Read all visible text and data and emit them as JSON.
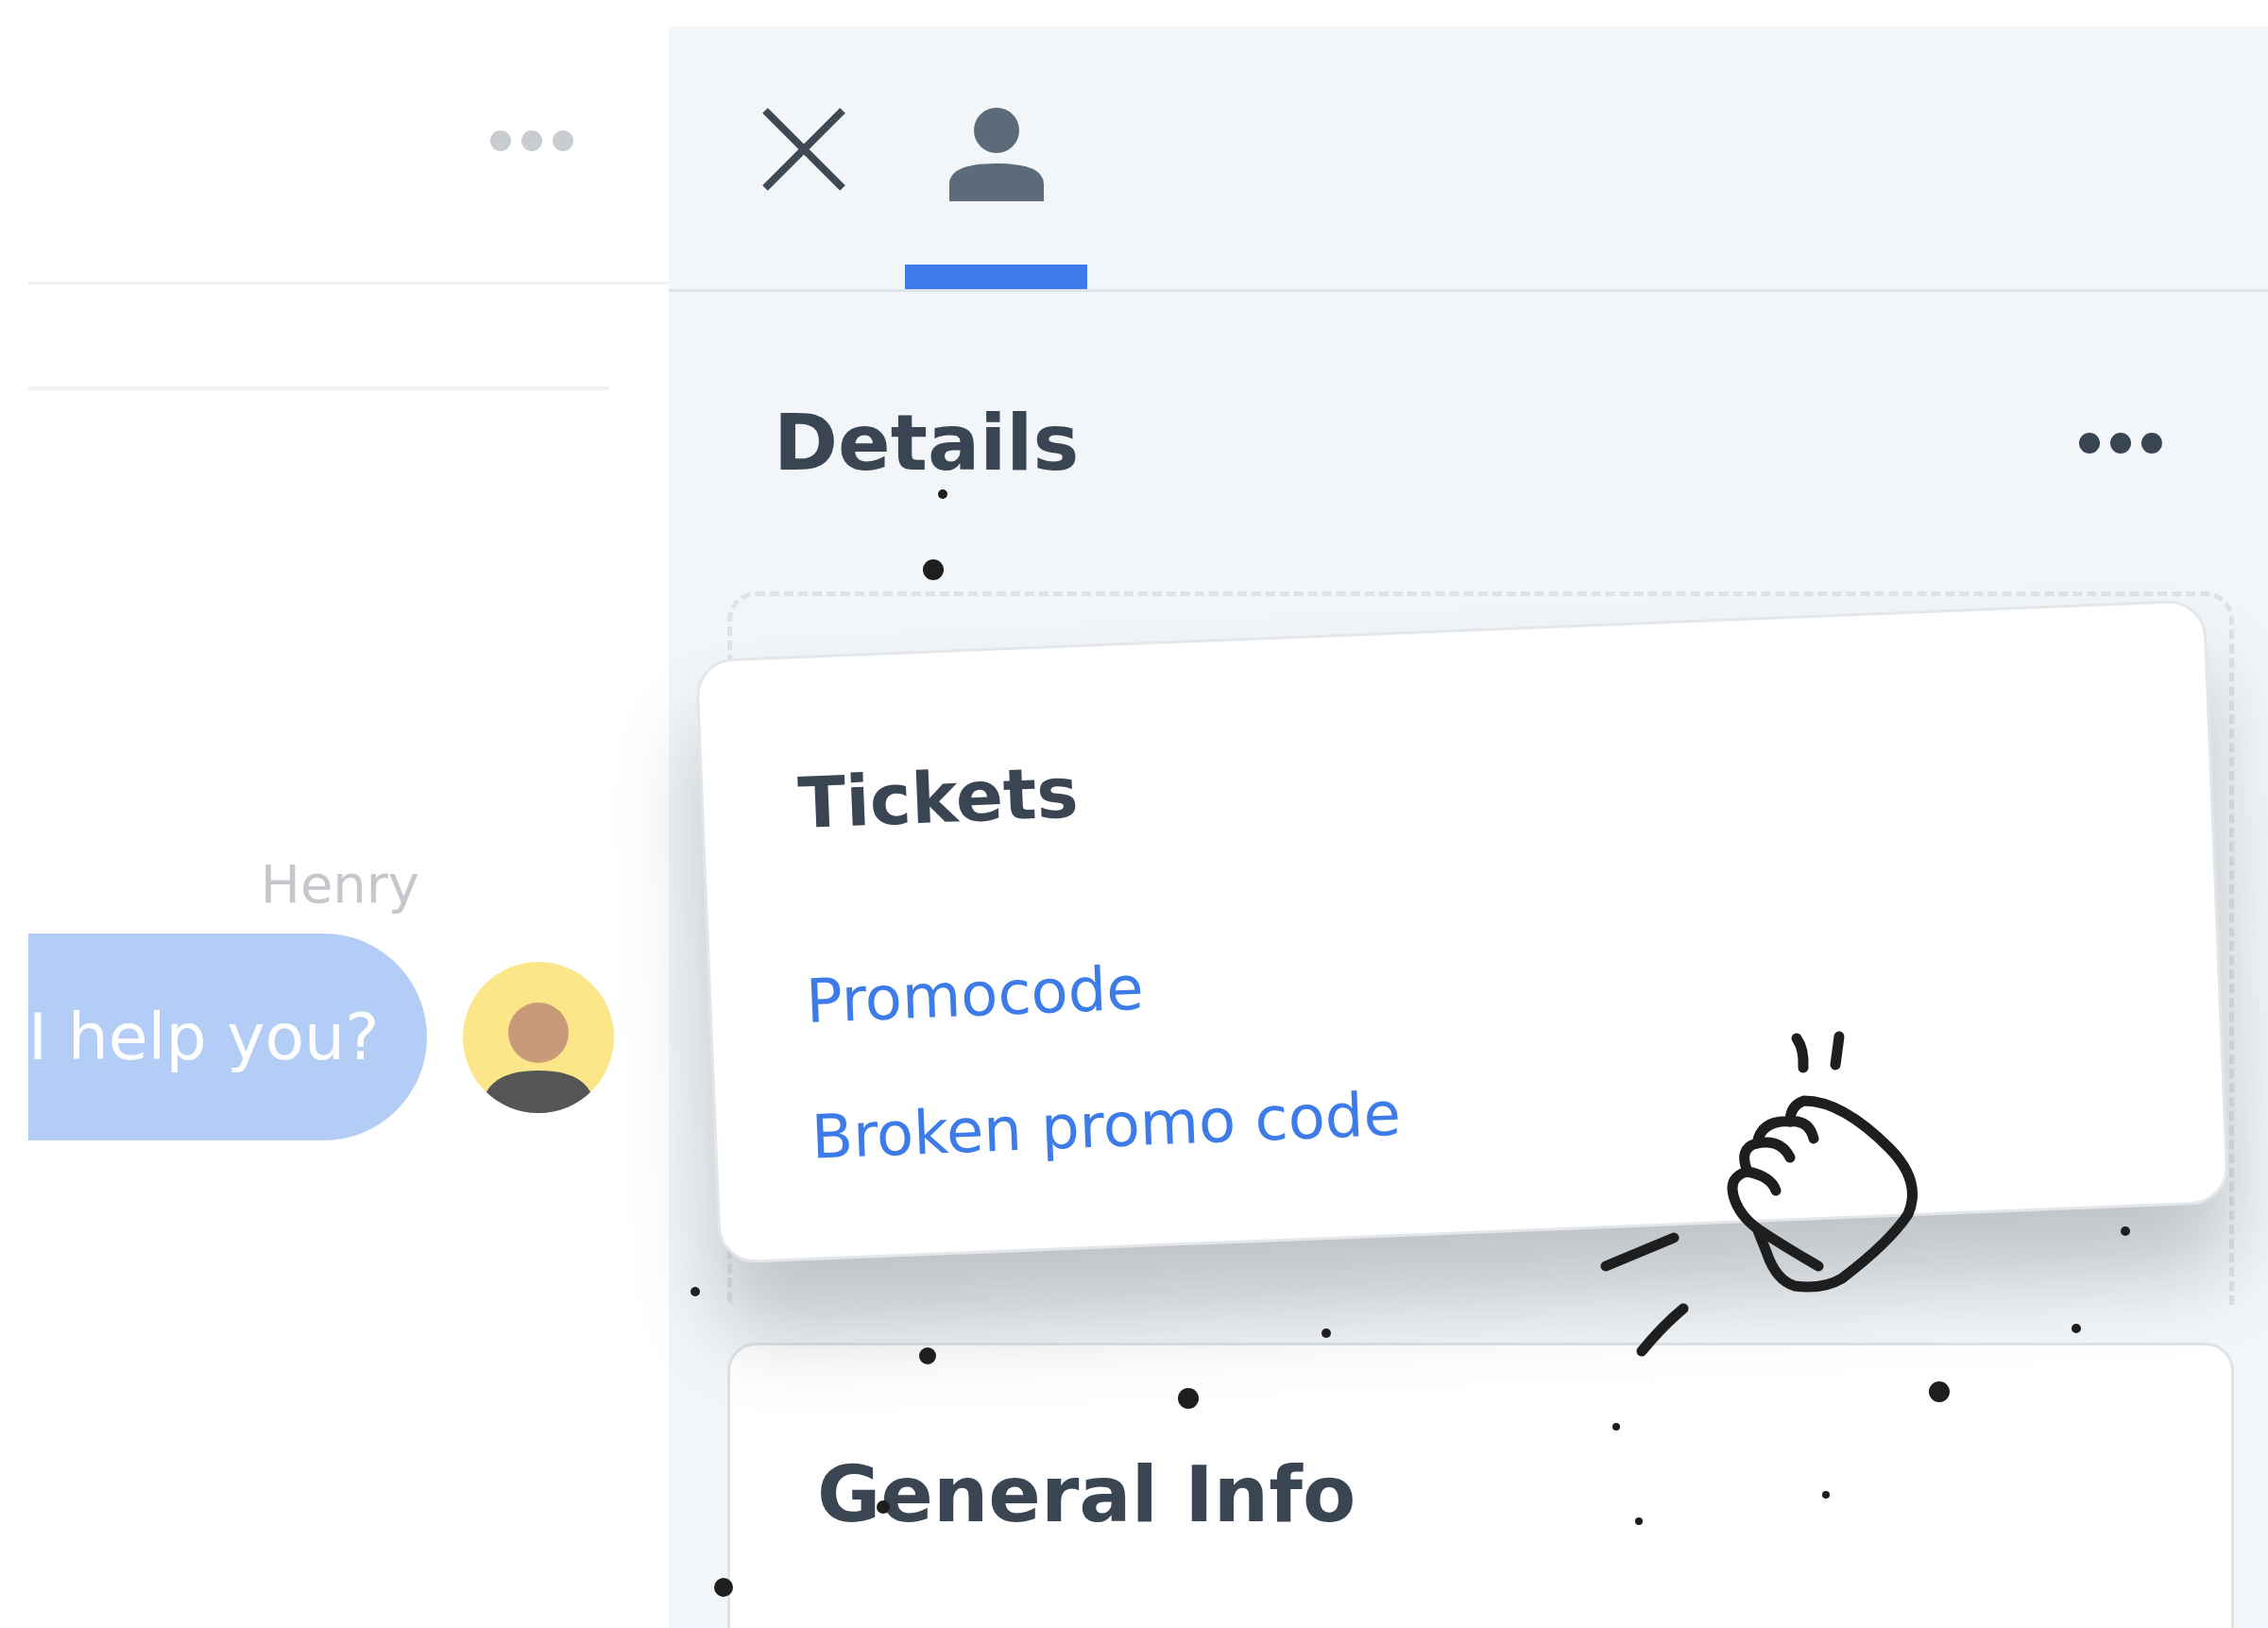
{
  "chat": {
    "sender": "Henry",
    "message": "I help you?"
  },
  "tabs": [
    {
      "kind": "close",
      "selected": false
    },
    {
      "kind": "profile",
      "selected": true
    }
  ],
  "details": {
    "title": "Details"
  },
  "tickets": {
    "title": "Tickets",
    "links": [
      "Promocode",
      "Broken promo code"
    ]
  },
  "general_info": {
    "title": "General Info"
  }
}
